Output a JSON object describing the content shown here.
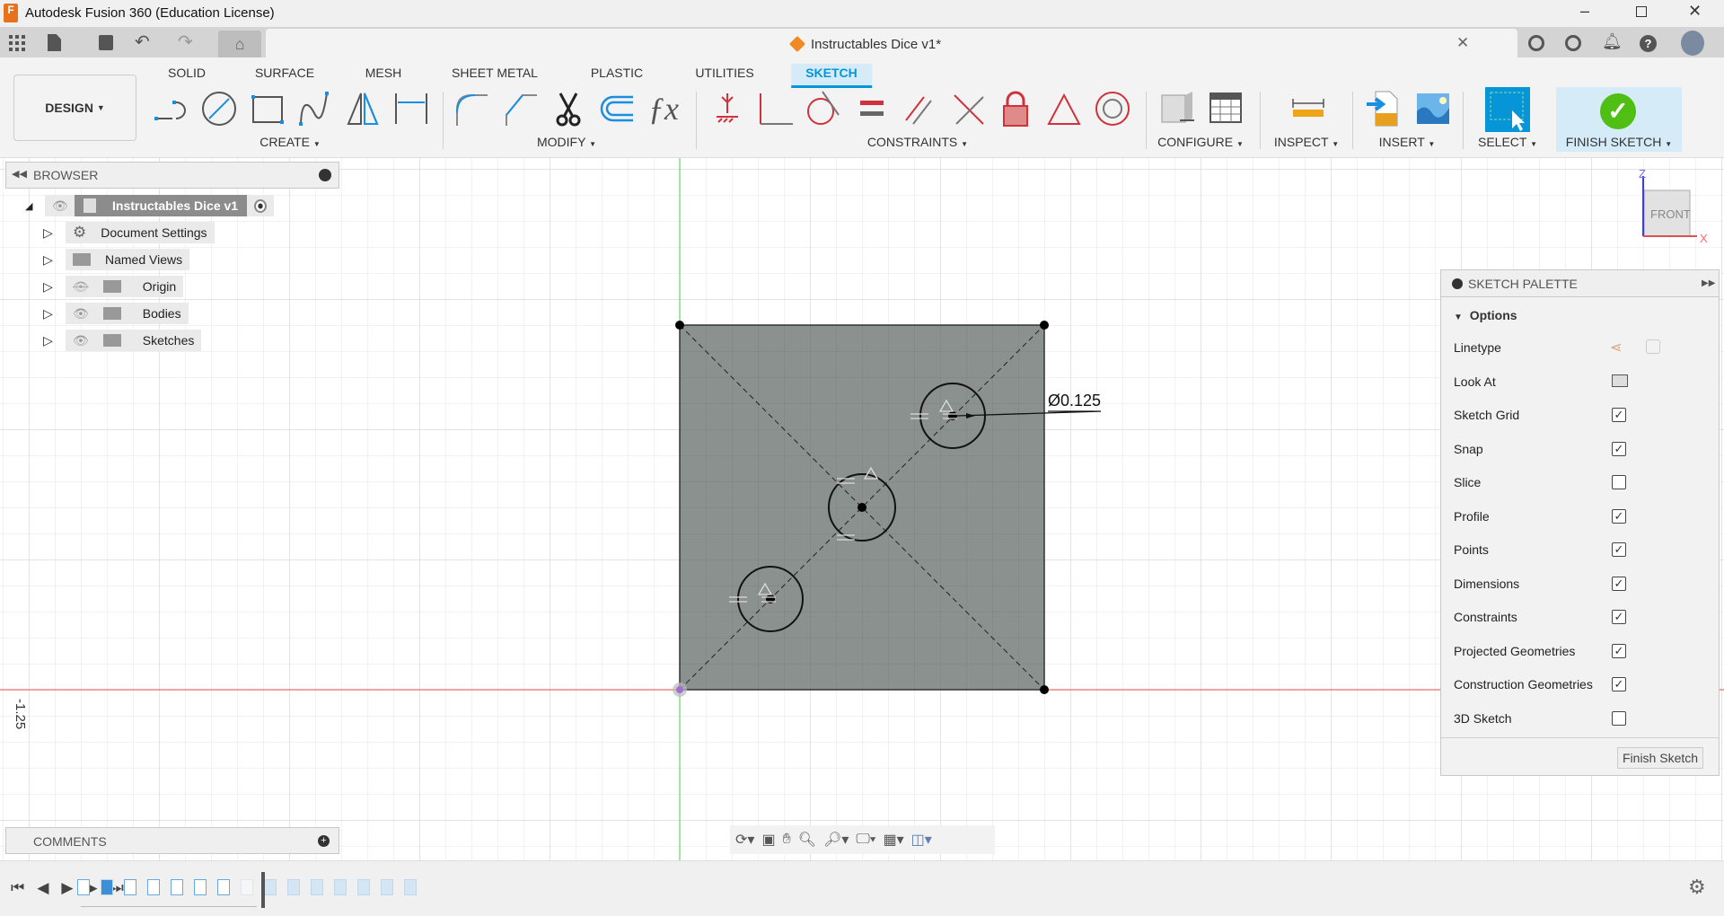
{
  "app": {
    "title": "Autodesk Fusion 360 (Education License)",
    "document_tab": "Instructables Dice v1*"
  },
  "ribbon": {
    "workspace": "DESIGN",
    "tabs": [
      "SOLID",
      "SURFACE",
      "MESH",
      "SHEET METAL",
      "PLASTIC",
      "UTILITIES",
      "SKETCH"
    ],
    "active_tab": "SKETCH",
    "groups": [
      "CREATE",
      "MODIFY",
      "CONSTRAINTS",
      "CONFIGURE",
      "INSPECT",
      "INSERT",
      "SELECT",
      "FINISH SKETCH"
    ]
  },
  "browser": {
    "title": "BROWSER",
    "root": "Instructables Dice v1",
    "items": [
      {
        "label": "Document Settings",
        "icon": "gear-icon"
      },
      {
        "label": "Named Views",
        "icon": "folder-icon"
      },
      {
        "label": "Origin",
        "icon": "folder-icon",
        "visible": false
      },
      {
        "label": "Bodies",
        "icon": "folder-icon",
        "visible": true
      },
      {
        "label": "Sketches",
        "icon": "folder-icon",
        "visible": true
      }
    ]
  },
  "viewport": {
    "dimension": "Ø0.125",
    "ruler_label": "-1.25",
    "viewcube": {
      "face": "FRONT",
      "axis_z": "Z",
      "axis_x": "X"
    },
    "colors": {
      "sketch_fill": "#8a918e",
      "x_axis": "#e05050",
      "y_axis": "#4ccc4c"
    }
  },
  "palette": {
    "title": "SKETCH PALETTE",
    "section": "Options",
    "rows": [
      {
        "label": "Linetype"
      },
      {
        "label": "Look At"
      },
      {
        "label": "Sketch Grid",
        "checked": true
      },
      {
        "label": "Snap",
        "checked": true
      },
      {
        "label": "Slice",
        "checked": false
      },
      {
        "label": "Profile",
        "checked": true
      },
      {
        "label": "Points",
        "checked": true
      },
      {
        "label": "Dimensions",
        "checked": true
      },
      {
        "label": "Constraints",
        "checked": true
      },
      {
        "label": "Projected Geometries",
        "checked": true
      },
      {
        "label": "Construction Geometries",
        "checked": true
      },
      {
        "label": "3D Sketch",
        "checked": false
      }
    ],
    "finish_button": "Finish Sketch"
  },
  "comments": {
    "title": "COMMENTS"
  },
  "check_mark": "✓"
}
